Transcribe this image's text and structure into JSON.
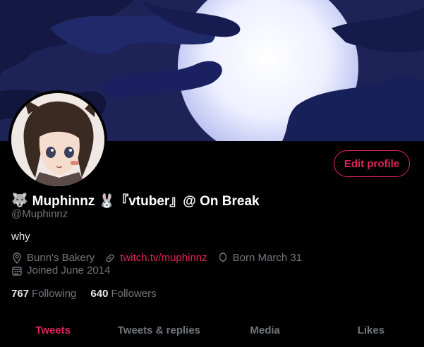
{
  "profile": {
    "display_name": "Muphinnz 🐰『vtuber』@ On Break",
    "name_emoji": "🐺",
    "handle": "@Muphinnz",
    "bio": "why",
    "edit_label": "Edit profile"
  },
  "meta": {
    "location": "Bunn's Bakery",
    "link": "twitch.tv/muphinnz",
    "birthday": "Born March 31",
    "joined": "Joined June 2014"
  },
  "stats": {
    "following_count": "767",
    "following_label": "Following",
    "followers_count": "640",
    "followers_label": "Followers"
  },
  "tabs": [
    {
      "label": "Tweets"
    },
    {
      "label": "Tweets & replies"
    },
    {
      "label": "Media"
    },
    {
      "label": "Likes"
    }
  ],
  "colors": {
    "accent": "#e0245e",
    "muted": "#71767b",
    "background": "#000000"
  },
  "icons": [
    "location-icon",
    "link-icon",
    "balloon-icon",
    "calendar-icon"
  ]
}
